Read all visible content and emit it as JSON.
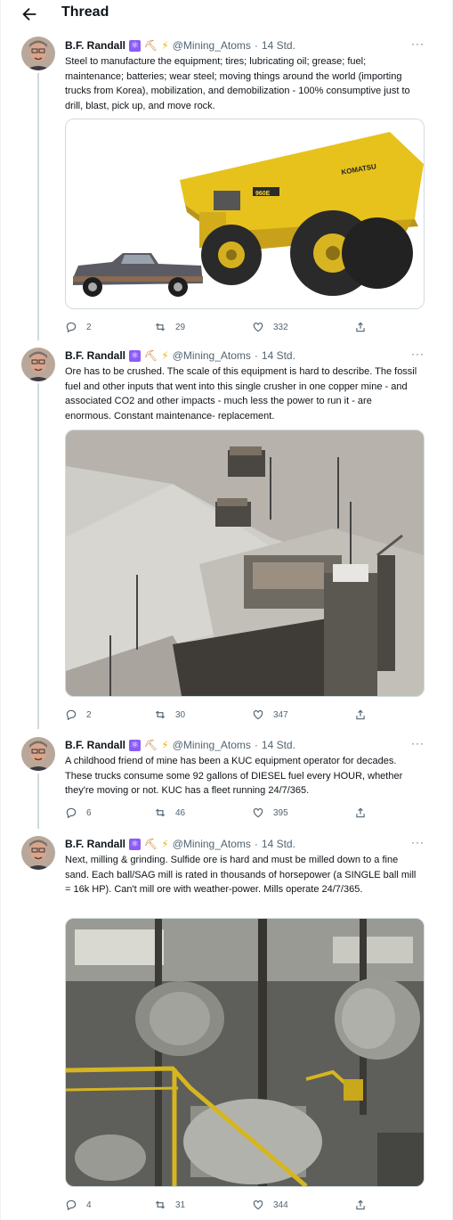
{
  "header": {
    "title": "Thread",
    "back_icon": "arrow-left-icon"
  },
  "tweets": [
    {
      "author": {
        "name": "B.F. Randall",
        "handle": "@Mining_Atoms",
        "time": "14 Std.",
        "emoji_icons": [
          "atom-icon",
          "pickaxe-icon",
          "lightning-icon"
        ]
      },
      "text": "Steel to manufacture the equipment; tires; lubricating oil; grease; fuel; maintenance; batteries; wear steel; moving things around the world (importing trucks from Korea), mobilization, and demobilization - 100% consumptive just to drill, blast, pick up, and move rock.",
      "media": {
        "kind": "haul-truck-vs-pickup",
        "truck_badge": "960E",
        "truck_brand": "KOMATSU"
      },
      "stats": {
        "replies": "2",
        "retweets": "29",
        "likes": "332"
      }
    },
    {
      "author": {
        "name": "B.F. Randall",
        "handle": "@Mining_Atoms",
        "time": "14 Std.",
        "emoji_icons": [
          "atom-icon",
          "pickaxe-icon",
          "lightning-icon"
        ]
      },
      "text": "Ore has to be crushed. The scale of this equipment is hard to describe. The fossil fuel and other inputs that went into this single crusher in one copper mine - and associated CO2 and other impacts - much less the power to run it - are enormous. Constant maintenance- replacement.",
      "media": {
        "kind": "crusher-quarry"
      },
      "stats": {
        "replies": "2",
        "retweets": "30",
        "likes": "347"
      }
    },
    {
      "author": {
        "name": "B.F. Randall",
        "handle": "@Mining_Atoms",
        "time": "14 Std.",
        "emoji_icons": [
          "atom-icon",
          "pickaxe-icon",
          "lightning-icon"
        ]
      },
      "text": "A childhood friend of mine has been a KUC equipment operator for decades. These trucks consume some 92 gallons of DIESEL fuel every HOUR, whether they're moving or not. KUC has a fleet running 24/7/365.",
      "stats": {
        "replies": "6",
        "retweets": "46",
        "likes": "395"
      }
    },
    {
      "author": {
        "name": "B.F. Randall",
        "handle": "@Mining_Atoms",
        "time": "14 Std.",
        "emoji_icons": [
          "atom-icon",
          "pickaxe-icon",
          "lightning-icon"
        ]
      },
      "text": "Next, milling & grinding. Sulfide ore is hard and must be milled down to a fine sand. Each ball/SAG mill is rated in thousands of horsepower (a SINGLE ball mill = 16k HP). Can't mill ore with weather-power. Mills operate 24/7/365.",
      "media": {
        "kind": "ball-mill-plant"
      },
      "stats": {
        "replies": "4",
        "retweets": "31",
        "likes": "344"
      }
    }
  ],
  "colors": {
    "text": "#0f1419",
    "secondary": "#536471",
    "border": "#cfd9de",
    "accent_atom": "#8b5cf6"
  }
}
